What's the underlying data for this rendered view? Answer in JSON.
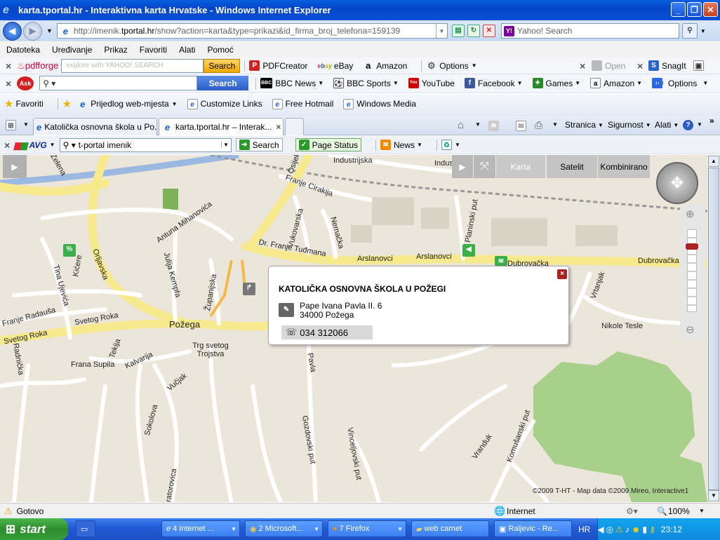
{
  "window": {
    "title": "karta.tportal.hr - Interaktivna karta Hrvatske - Windows Internet Explorer",
    "controls": {
      "minimize": "_",
      "maximize": "❐",
      "close": "✕"
    }
  },
  "address": {
    "url_prefix": "http://imenik.",
    "url_domain": "tportal.hr",
    "url_rest": "/show?action=karta&type=prikazi&id_firma_broj_telefona=159139",
    "search_placeholder": "Yahoo! Search"
  },
  "menu": [
    "Datoteka",
    "Uređivanje",
    "Prikaz",
    "Favoriti",
    "Alati",
    "Pomoć"
  ],
  "pdfforge_toolbar": {
    "brand": "pdfforge",
    "search_placeholder": "explore with YAHOO! SEARCH",
    "search_button": "Search",
    "items": [
      "PDFCreator",
      "eBay",
      "Amazon",
      "Options"
    ],
    "right_items": [
      "Open",
      "SnagIt"
    ]
  },
  "ask_toolbar": {
    "search_button": "Search",
    "items": [
      "BBC News",
      "BBC Sports",
      "YouTube",
      "Facebook",
      "Games",
      "Amazon"
    ],
    "options": "Options"
  },
  "favorites_bar": {
    "favorites": "Favoriti",
    "items": [
      "Prijedlog web-mjesta",
      "Customize Links",
      "Free Hotmail",
      "Windows Media"
    ]
  },
  "tabs": [
    {
      "label": "Katolička osnovna škola u Po..."
    },
    {
      "label": "karta.tportal.hr – Interak..."
    }
  ],
  "command_bar": [
    "Stranica",
    "Sigurnost",
    "Alati"
  ],
  "avg_toolbar": {
    "brand": "AVG",
    "search_value": "t-portal imenik",
    "search_button": "Search",
    "page_status": "Page Status",
    "news": "News"
  },
  "map": {
    "tabs": [
      "Karta",
      "Satelit",
      "Kombinirano"
    ],
    "copyright": "©2009 T-HT - Map data ©2009 Mireo, Interactive1",
    "labels": [
      "Zelena",
      "Osijek",
      "Industrijska",
      "Indus",
      "Franje Cirakija",
      "Antuna Mihanovića",
      "Vukovarska",
      "Nemačka",
      "Planinski put",
      "Dr. Franje Tuđmana",
      "Arslanovci",
      "Arslanovci",
      "Dubrovačka",
      "Dubrovačka",
      "Kićere",
      "Orljavska",
      "Julija Kempfa",
      "Županijska",
      "Tina Ujevića",
      "Franje Radauša",
      "Svetog Roka",
      "Svetog Roka",
      "Požega",
      "Trg svetog Trojstva",
      "Radnička",
      "Frana Supila",
      "Tekija",
      "Kalvarija",
      "Vrtanjak",
      "Nikole Tesle",
      "Sokolova",
      "Vučjak",
      "Gozdovski put",
      "Vinceljovski put",
      "Vranduk",
      "Komušanski put",
      "Pavla",
      "ratorovica"
    ]
  },
  "popup": {
    "title": "KATOLIČKA OSNOVNA ŠKOLA U POŽEGI",
    "address_line1": "Pape Ivana Pavla II. 6",
    "address_line2": "34000 Požega",
    "phone": "034 312066"
  },
  "status": {
    "text": "Gotovo",
    "zone": "Internet",
    "zoom": "100%"
  },
  "taskbar": {
    "start": "start",
    "tasks": [
      "4 Internet ...",
      "2 Microsoft...",
      "7 Firefox",
      "web carnet",
      "Raljevic - Re..."
    ],
    "lang": "HR",
    "time": "23:12"
  }
}
